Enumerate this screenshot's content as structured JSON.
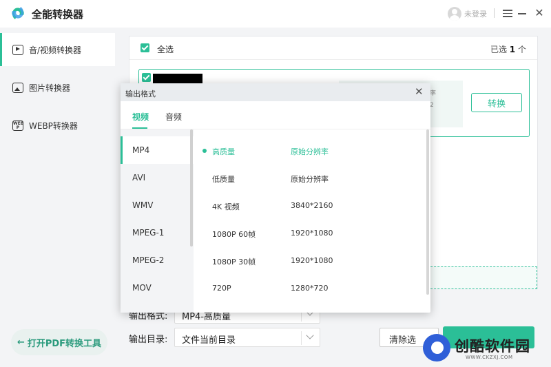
{
  "app": {
    "title": "全能转换器"
  },
  "titlebar": {
    "login_text": "未登录"
  },
  "sidebar": {
    "items": [
      {
        "label": "音/视频转换器",
        "icon": "video-icon"
      },
      {
        "label": "图片转换器",
        "icon": "image-icon"
      },
      {
        "label": "WEBP转换器",
        "icon": "webp-icon"
      }
    ],
    "pdf_button": "打开PDF转换工具",
    "webp_icon_text": "WEB\nP"
  },
  "main": {
    "select_all": "全选",
    "selected_prefix": "已选",
    "selected_count": "1",
    "selected_suffix": "个",
    "card_info_line1": "率",
    "card_info_line2": "2",
    "convert_button": "转换"
  },
  "bottom": {
    "format_label": "输出格式:",
    "format_value": "MP4-高质量",
    "dir_label": "输出目录:",
    "dir_value": "文件当前目录",
    "clear_button": "清除选"
  },
  "watermark": {
    "text": "创酷软件园",
    "url": "WWW.CKZXJ.COM"
  },
  "modal": {
    "title": "输出格式",
    "tabs": [
      "视频",
      "音频"
    ],
    "formats": [
      "MP4",
      "AVI",
      "WMV",
      "MPEG-1",
      "MPEG-2",
      "MOV"
    ],
    "qualities": [
      {
        "name": "高质量",
        "res": "原始分辨率"
      },
      {
        "name": "低质量",
        "res": "原始分辨率"
      },
      {
        "name": "4K 视频",
        "res": "3840*2160"
      },
      {
        "name": "1080P 60帧",
        "res": "1920*1080"
      },
      {
        "name": "1080P 30帧",
        "res": "1920*1080"
      },
      {
        "name": "720P",
        "res": "1280*720"
      }
    ]
  },
  "colors": {
    "accent": "#2bbf97",
    "watermark_blue": "#2f5fd8"
  }
}
